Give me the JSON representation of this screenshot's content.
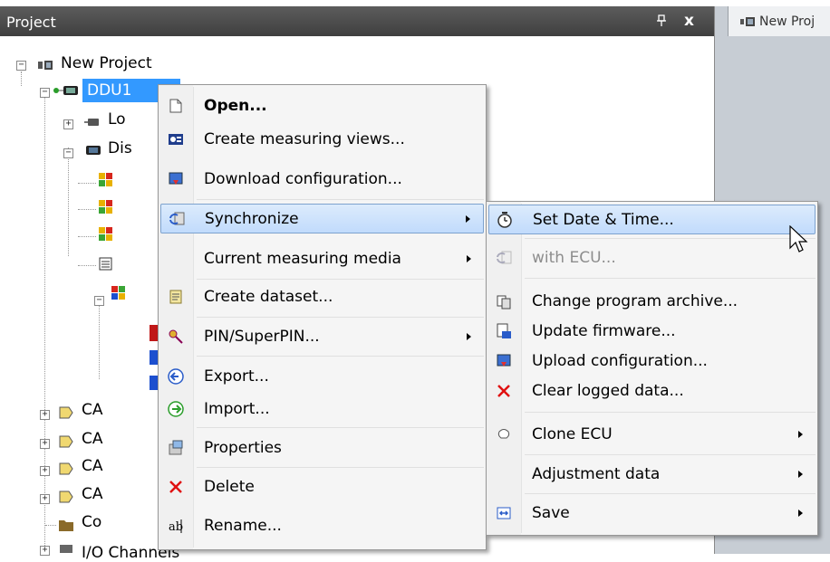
{
  "panel": {
    "title": "Project",
    "close_label": "x"
  },
  "document_tab": {
    "label": "New Proj"
  },
  "tree": {
    "root": "New Project",
    "ecu": "DDU1",
    "nodes": [
      "Lo",
      "Dis",
      "CA",
      "CA",
      "CA",
      "CA",
      "Co",
      "I/O Channels"
    ]
  },
  "context_menu": {
    "items": [
      {
        "label": "Open...",
        "icon": "open-document-icon"
      },
      {
        "label": "Create measuring views...",
        "icon": "measuring-view-icon"
      },
      {
        "label": "Download configuration...",
        "icon": "download-icon"
      },
      {
        "label": "Synchronize",
        "icon": "synchronize-icon"
      },
      {
        "label": "Current measuring media",
        "icon": ""
      },
      {
        "label": "Create dataset...",
        "icon": "dataset-icon"
      },
      {
        "label": "PIN/SuperPIN...",
        "icon": "key-icon"
      },
      {
        "label": "Export...",
        "icon": "export-icon"
      },
      {
        "label": "Import...",
        "icon": "import-icon"
      },
      {
        "label": "Properties",
        "icon": "properties-icon"
      },
      {
        "label": "Delete",
        "icon": "delete-icon"
      },
      {
        "label": "Rename...",
        "icon": "rename-icon"
      }
    ]
  },
  "submenu": {
    "items": [
      {
        "label": "Set Date & Time...",
        "icon": "clock-icon"
      },
      {
        "label": "with ECU...",
        "icon": "sync-ecu-icon"
      },
      {
        "label": "Change program archive...",
        "icon": "archive-icon"
      },
      {
        "label": "Update firmware...",
        "icon": "firmware-icon"
      },
      {
        "label": "Upload configuration...",
        "icon": "upload-icon"
      },
      {
        "label": "Clear logged data...",
        "icon": "delete-icon"
      },
      {
        "label": "Clone ECU",
        "icon": "clone-icon"
      },
      {
        "label": "Adjustment data",
        "icon": ""
      },
      {
        "label": "Save",
        "icon": "save-icon"
      }
    ]
  },
  "colors": {
    "header_bg": "#4a4a4a",
    "selection": "#3399ff",
    "menu_highlight": "#c1dbfc",
    "delete_red": "#e01010"
  }
}
